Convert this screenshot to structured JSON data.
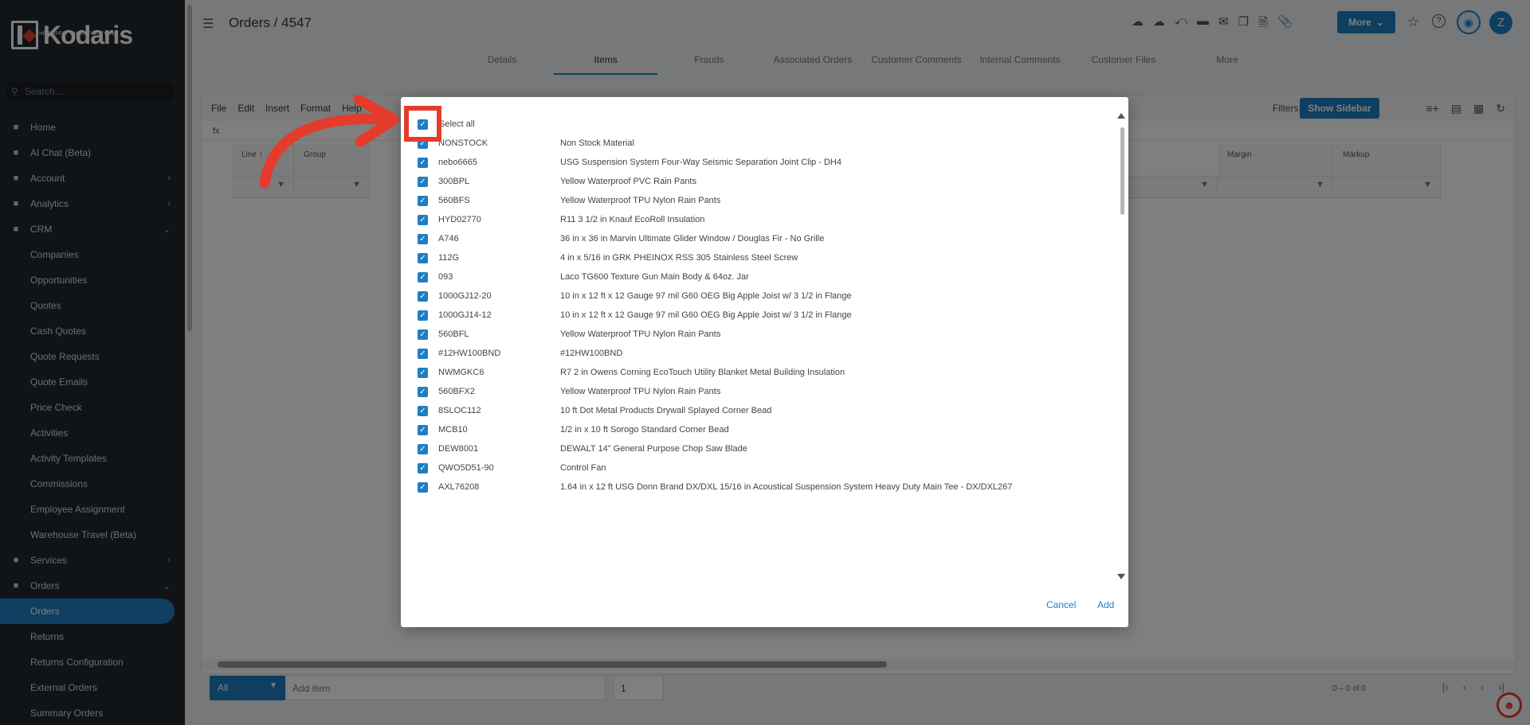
{
  "brand": {
    "name": "Kodaris",
    "tagline": "THE SUPPLY CHAIN PLATFORM",
    "accent": "#1f7ec1",
    "highlight": "#e53b2d"
  },
  "sidebar": {
    "search_placeholder": "Search...",
    "items": [
      {
        "label": "Home",
        "icon": "home-icon",
        "arrow": ""
      },
      {
        "label": "AI Chat (Beta)",
        "icon": "robot-icon",
        "arrow": ""
      },
      {
        "label": "Account",
        "icon": "person-icon",
        "arrow": "›"
      },
      {
        "label": "Analytics",
        "icon": "chart-icon",
        "arrow": "›"
      },
      {
        "label": "CRM",
        "icon": "contacts-icon",
        "arrow": "⌄"
      },
      {
        "label": "Companies",
        "sub": true
      },
      {
        "label": "Opportunities",
        "sub": true
      },
      {
        "label": "Quotes",
        "sub": true
      },
      {
        "label": "Cash Quotes",
        "sub": true
      },
      {
        "label": "Quote Requests",
        "sub": true
      },
      {
        "label": "Quote Emails",
        "sub": true
      },
      {
        "label": "Price Check",
        "sub": true
      },
      {
        "label": "Activities",
        "sub": true
      },
      {
        "label": "Activity Templates",
        "sub": true
      },
      {
        "label": "Commissions",
        "sub": true
      },
      {
        "label": "Employee Assignment",
        "sub": true
      },
      {
        "label": "Warehouse Travel (Beta)",
        "sub": true
      },
      {
        "label": "Services",
        "icon": "services-icon",
        "arrow": "›"
      },
      {
        "label": "Orders",
        "icon": "car-icon",
        "arrow": "⌄"
      },
      {
        "label": "Orders",
        "sub": true,
        "active": true
      },
      {
        "label": "Returns",
        "sub": true
      },
      {
        "label": "Returns Configuration",
        "sub": true
      },
      {
        "label": "External Orders",
        "sub": true
      },
      {
        "label": "Summary Orders",
        "sub": true
      }
    ]
  },
  "header": {
    "breadcrumb": "Orders / 4547",
    "more_label": "More",
    "avatar_initial": "Z"
  },
  "tabs": [
    "Details",
    "Items",
    "Frauds",
    "Associated Orders",
    "Customer Comments",
    "Internal Comments",
    "Customer Files",
    "More"
  ],
  "grid": {
    "menu": [
      "File",
      "Edit",
      "Insert",
      "Format",
      "Help"
    ],
    "filters_label": "Filters",
    "show_sidebar_label": "Show Sidebar",
    "fx_label": "fx",
    "columns": [
      "Line",
      "Group",
      "Margin",
      "Markup"
    ]
  },
  "bottom": {
    "select_label": "All",
    "add_item_placeholder": "Add item",
    "qty_value": "1",
    "pager_text": "0 – 0 of 0"
  },
  "modal": {
    "select_all_label": "Select all",
    "cancel_label": "Cancel",
    "add_label": "Add",
    "items": [
      {
        "code": "NONSTOCK",
        "desc": "Non Stock Material"
      },
      {
        "code": "nebo6665",
        "desc": "USG Suspension System Four-Way Seismic Separation Joint Clip - DH4"
      },
      {
        "code": "300BPL",
        "desc": "Yellow Waterproof PVC Rain Pants"
      },
      {
        "code": "560BFS",
        "desc": "Yellow Waterproof TPU Nylon Rain Pants"
      },
      {
        "code": "HYD02770",
        "desc": "R11 3 1/2 in Knauf EcoRoll Insulation"
      },
      {
        "code": "A746",
        "desc": "36 in x 36 in Marvin Ultimate Glider Window / Douglas Fir - No Grille"
      },
      {
        "code": "112G",
        "desc": "4 in x 5/16 in GRK PHEINOX RSS 305 Stainless Steel Screw"
      },
      {
        "code": "093",
        "desc": "Laco TG600 Texture Gun Main Body & 64oz. Jar"
      },
      {
        "code": "1000GJ12-20",
        "desc": "10 in x 12 ft x 12 Gauge 97 mil G60 OEG Big Apple Joist w/ 3 1/2 in Flange"
      },
      {
        "code": "1000GJ14-12",
        "desc": "10 in x 12 ft x 12 Gauge 97 mil G60 OEG Big Apple Joist w/ 3 1/2 in Flange"
      },
      {
        "code": "560BFL",
        "desc": "Yellow Waterproof TPU Nylon Rain Pants"
      },
      {
        "code": "#12HW100BND",
        "desc": "#12HW100BND"
      },
      {
        "code": "NWMGKC6",
        "desc": "R7 2 in Owens Corning EcoTouch Utility Blanket Metal Building Insulation"
      },
      {
        "code": "560BFX2",
        "desc": "Yellow Waterproof TPU Nylon Rain Pants"
      },
      {
        "code": "8SLOC112",
        "desc": "10 ft Dot Metal Products Drywall Splayed Corner Bead"
      },
      {
        "code": "MCB10",
        "desc": "1/2 in x 10 ft Sorogo Standard Corner Bead"
      },
      {
        "code": "DEW8001",
        "desc": "DEWALT 14\" General Purpose Chop Saw Blade"
      },
      {
        "code": "QWO5D51-90",
        "desc": "Control Fan"
      },
      {
        "code": "AXL76208",
        "desc": "1.64 in x 12 ft USG Donn Brand DX/DXL 15/16 in Acoustical Suspension System Heavy Duty Main Tee - DX/DXL267"
      }
    ]
  }
}
